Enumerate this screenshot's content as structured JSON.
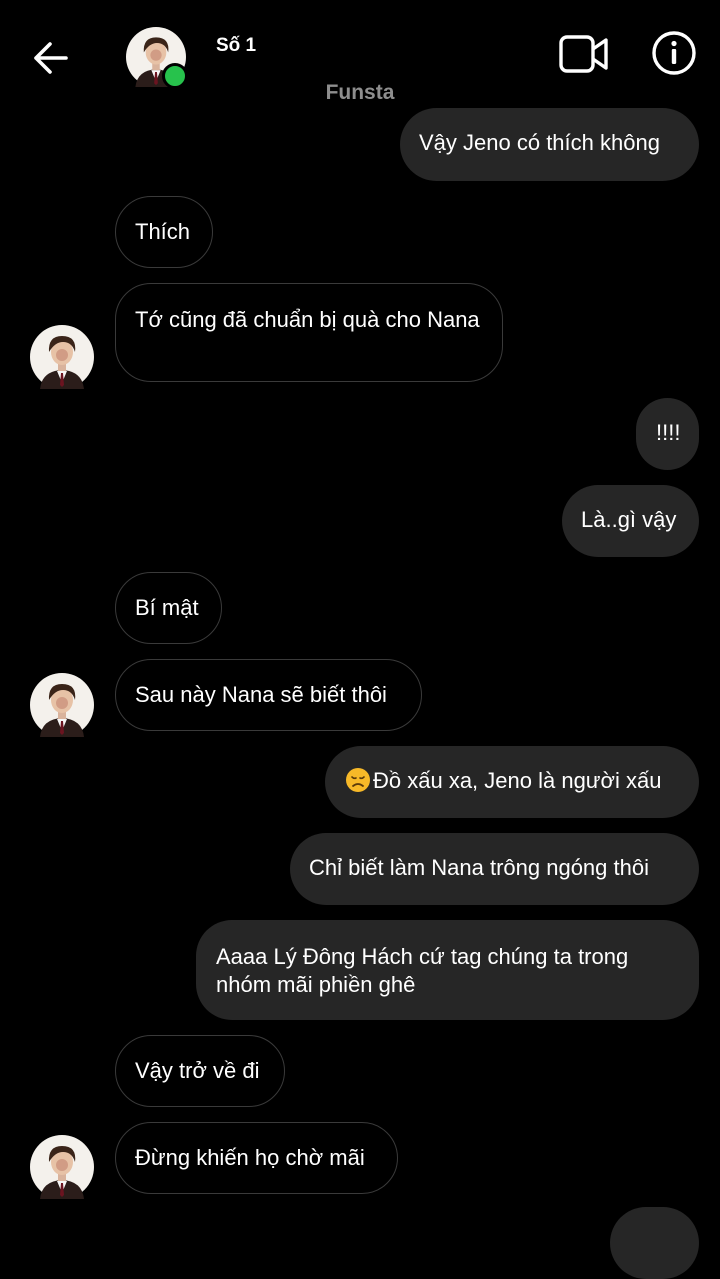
{
  "header": {
    "contact_name": "Số 1",
    "subtitle": "Funsta",
    "back_icon": "arrow-left-icon",
    "video_icon": "video-camera-icon",
    "info_icon": "info-icon",
    "online_status_color": "#27c24c"
  },
  "colors": {
    "background": "#000000",
    "outgoing_bubble": "#262626",
    "incoming_border": "#3a3a3a",
    "subtitle_text": "#8e8e8e"
  },
  "messages": [
    {
      "direction": "outgoing",
      "text": "Vậy Jeno có thích không"
    },
    {
      "direction": "incoming",
      "text": "Thích"
    },
    {
      "direction": "incoming",
      "text": "Tớ cũng đã chuẩn bị quà cho Nana",
      "avatar": true
    },
    {
      "direction": "outgoing",
      "text": "!!!!"
    },
    {
      "direction": "outgoing",
      "text": "Là..gì vậy"
    },
    {
      "direction": "incoming",
      "text": "Bí mật"
    },
    {
      "direction": "incoming",
      "text": "Sau này Nana sẽ biết thôi",
      "avatar": true
    },
    {
      "direction": "outgoing",
      "emoji": "disappointed-face",
      "text": "Đồ xấu xa, Jeno là người xấu"
    },
    {
      "direction": "outgoing",
      "text": "Chỉ biết làm Nana trông ngóng thôi"
    },
    {
      "direction": "outgoing",
      "text": "Aaaa Lý Đông Hách cứ tag chúng ta trong nhóm mãi phiền ghê"
    },
    {
      "direction": "incoming",
      "text": "Vậy trở về đi"
    },
    {
      "direction": "incoming",
      "text": "Đừng khiến họ chờ mãi",
      "avatar": true
    }
  ]
}
